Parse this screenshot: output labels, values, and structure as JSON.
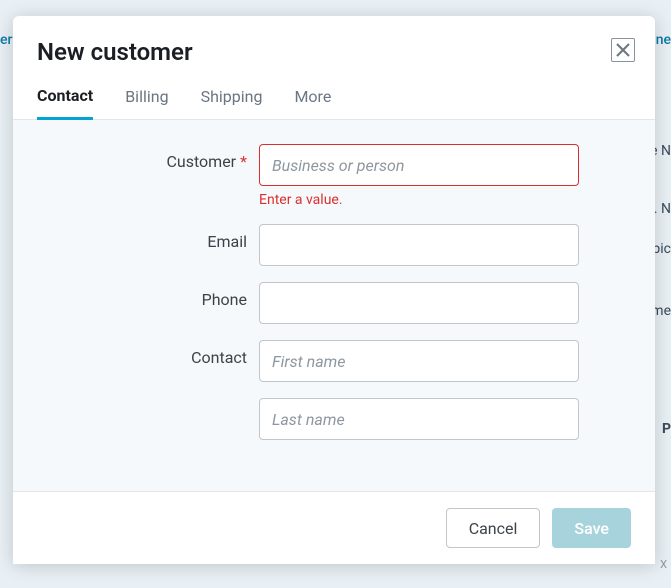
{
  "modal": {
    "title": "New customer",
    "tabs": {
      "contact": "Contact",
      "billing": "Billing",
      "shipping": "Shipping",
      "more": "More"
    }
  },
  "form": {
    "customer": {
      "label": "Customer",
      "required_mark": "*",
      "placeholder": "Business or person",
      "error": "Enter a value."
    },
    "email": {
      "label": "Email"
    },
    "phone": {
      "label": "Phone"
    },
    "contact": {
      "label": "Contact",
      "first_placeholder": "First name",
      "last_placeholder": "Last name"
    }
  },
  "footer": {
    "cancel": "Cancel",
    "save": "Save"
  },
  "background": {
    "t1": "er",
    "t2": "ne",
    "t3": "e N",
    "t4": ". N",
    "t5": "pic",
    "t6": "me",
    "t7": "P",
    "t8": "X"
  }
}
